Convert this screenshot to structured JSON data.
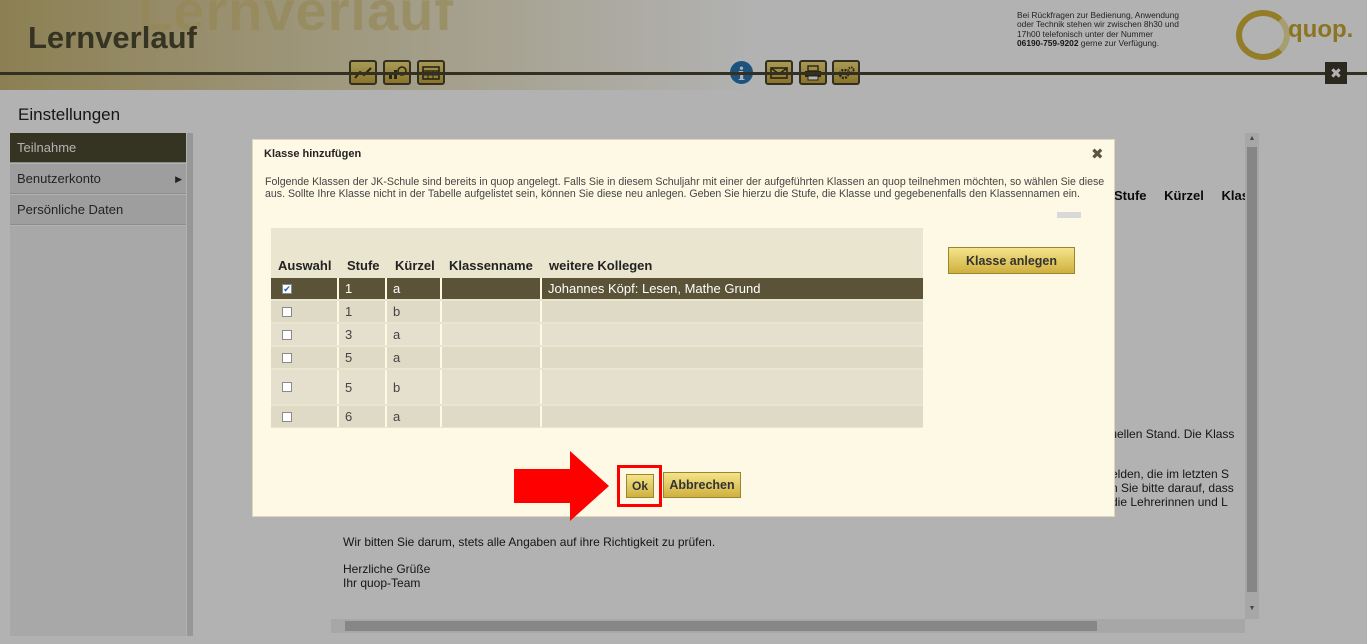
{
  "header": {
    "title": "Lernverlauf",
    "watermark": "Lernverlauf",
    "contact_lines": [
      "Bei Rückfragen zur Bedienung, Anwendung",
      "oder Technik stehen wir zwischen 8h30 und",
      "17h00 telefonisch unter der Nummer"
    ],
    "contact_phone": "06190-759-9202",
    "contact_suffix": " gerne zur Verfügung.",
    "logo_text": "quop.",
    "info_icon": "i",
    "close_icon": "✖"
  },
  "sidebar": {
    "heading": "Einstellungen",
    "items": [
      {
        "label": "Teilnahme",
        "active": true
      },
      {
        "label": "Benutzerkonto",
        "has_submenu": true,
        "arrow": "▶"
      },
      {
        "label": "Persönliche Daten"
      }
    ]
  },
  "background": {
    "headers": [
      "Stufe",
      "Kürzel",
      "Klas"
    ],
    "text_1": "ktuellen Stand. Die Klass",
    "text_2": "melden, die im letzten S",
    "text_3": "ten Sie bitte darauf, dass",
    "text_4": "d die Lehrerinnen und L",
    "text_5": "Wir bitten Sie darum, stets alle Angaben auf ihre Richtigkeit zu prüfen.",
    "text_6": "Herzliche Grüße",
    "text_7": "Ihr quop-Team"
  },
  "dialog": {
    "title": "Klasse hinzufügen",
    "close_icon": "✖",
    "description": "Folgende Klassen der JK-Schule sind bereits in quop angelegt. Falls Sie in diesem Schuljahr mit einer der aufgeführten Klassen an quop teilnehmen möchten, so wählen Sie diese aus. Sollte Ihre Klasse nicht in der Tabelle aufgelistet sein, können Sie diese neu anlegen. Geben Sie hierzu die Stufe, die Klasse und gegebenenfalls den Klassennamen ein.",
    "add_class_button": "Klasse anlegen",
    "ok_button": "Ok",
    "cancel_button": "Abbrechen",
    "table": {
      "headers": [
        "Auswahl",
        "Stufe",
        "Kürzel",
        "Klassenname",
        "weitere Kollegen"
      ],
      "rows": [
        {
          "checked": true,
          "check_mark": "✔",
          "stufe": "1",
          "kuerzel": "a",
          "name": "",
          "kollegen": "Johannes Köpf: Lesen, Mathe Grund"
        },
        {
          "checked": false,
          "stufe": "1",
          "kuerzel": "b",
          "name": "",
          "kollegen": ""
        },
        {
          "checked": false,
          "stufe": "3",
          "kuerzel": "a",
          "name": "",
          "kollegen": ""
        },
        {
          "checked": false,
          "stufe": "5",
          "kuerzel": "a",
          "name": "",
          "kollegen": ""
        },
        {
          "checked": false,
          "stufe": "5",
          "kuerzel": "b",
          "name": "",
          "kollegen": ""
        },
        {
          "checked": false,
          "stufe": "6",
          "kuerzel": "a",
          "name": "",
          "kollegen": ""
        }
      ]
    }
  }
}
